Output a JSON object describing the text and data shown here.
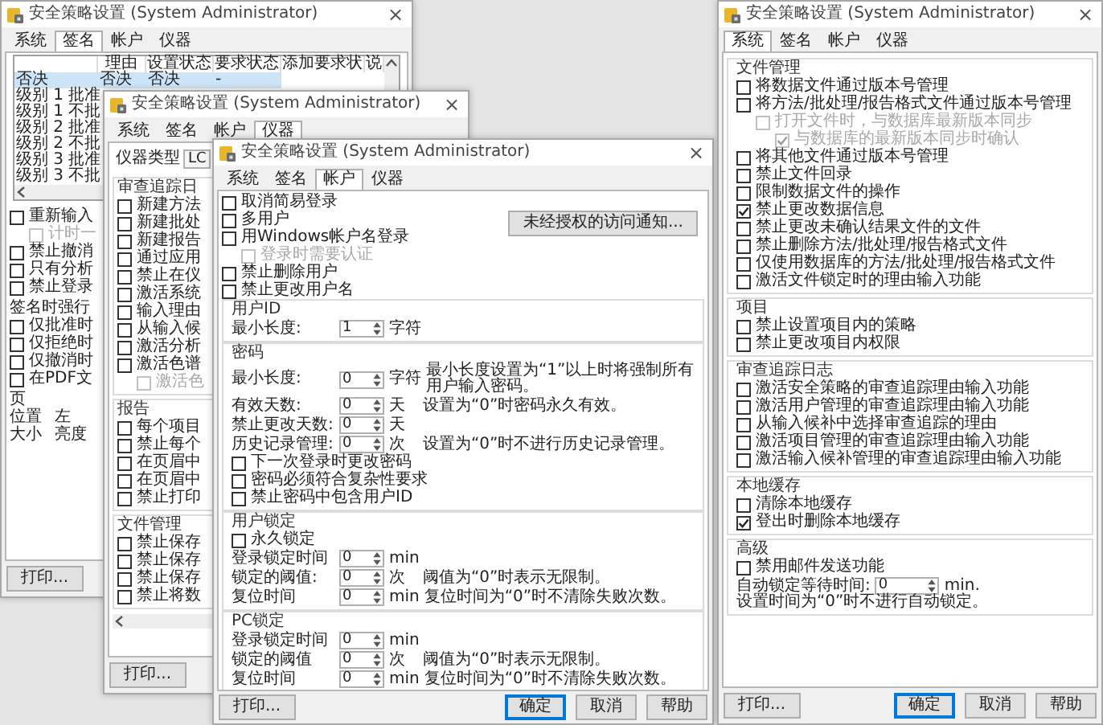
{
  "windows": [
    {
      "title": "安全策略设置 (System Administrator)",
      "close": "×",
      "tabs": [
        {
          "label": "系统",
          "selected": false
        },
        {
          "label": "签名",
          "selected": true
        },
        {
          "label": "帐户",
          "selected": false
        },
        {
          "label": "仪器",
          "selected": false
        }
      ],
      "body": [
        {
          "kind": "table",
          "columns": [
            "理由",
            "设置状态",
            "要求状态",
            "添加要求状",
            "说"
          ],
          "rows": [
            {
              "name": "否决",
              "cells": [
                "否决",
                "否决",
                "-"
              ],
              "selected": true
            },
            {
              "name": "级别 1 批准",
              "selected": false
            },
            {
              "name": "级别 1 不批",
              "selected": false
            },
            {
              "name": "级别 2 批准",
              "selected": false
            },
            {
              "name": "级别 2 不批",
              "selected": false
            },
            {
              "name": "级别 3 批准",
              "selected": false
            },
            {
              "name": "级别 3 不批",
              "selected": false
            }
          ]
        },
        {
          "kind": "checkbox",
          "label": "重新输入",
          "checked": false,
          "disabled": false,
          "children": [
            {
              "kind": "checkbox",
              "label": "计时一",
              "checked": false,
              "disabled": true
            }
          ]
        },
        {
          "kind": "checkbox",
          "label": "禁止撤消",
          "checked": false,
          "disabled": false
        },
        {
          "kind": "checkbox",
          "label": "只有分析",
          "checked": false,
          "disabled": false
        },
        {
          "kind": "checkbox",
          "label": "禁止登录",
          "checked": false,
          "disabled": false
        },
        {
          "kind": "label",
          "text": "签名时强行"
        },
        {
          "kind": "checkbox",
          "label": "仅批准时",
          "checked": false,
          "disabled": false
        },
        {
          "kind": "checkbox",
          "label": "仅拒绝时",
          "checked": false,
          "disabled": false
        },
        {
          "kind": "checkbox",
          "label": "仅撤消时",
          "checked": false,
          "disabled": false
        },
        {
          "kind": "checkbox",
          "label": "在PDF文",
          "checked": false,
          "disabled": false
        },
        {
          "kind": "label",
          "text": "页"
        },
        {
          "kind": "pair",
          "label": "位置",
          "value": "左"
        },
        {
          "kind": "pair",
          "label": "大小",
          "value": "亮度"
        }
      ],
      "buttons": [
        {
          "label": "打印...",
          "kind": "side"
        }
      ]
    },
    {
      "title": "安全策略设置 (System Administrator)",
      "close": "×",
      "tabs": [
        {
          "label": "系统",
          "selected": false
        },
        {
          "label": "签名",
          "selected": false
        },
        {
          "label": "帐户",
          "selected": false
        },
        {
          "label": "仪器",
          "selected": true
        }
      ],
      "body": [
        {
          "kind": "select",
          "label": "仪器类型",
          "value": "LC"
        },
        {
          "kind": "group",
          "title": "审查追踪日",
          "items": [
            {
              "kind": "checkbox",
              "label": "新建方法",
              "checked": false,
              "disabled": false
            },
            {
              "kind": "checkbox",
              "label": "新建批处",
              "checked": false,
              "disabled": false
            },
            {
              "kind": "checkbox",
              "label": "新建报告",
              "checked": false,
              "disabled": false
            },
            {
              "kind": "checkbox",
              "label": "通过应用",
              "checked": false,
              "disabled": false
            },
            {
              "kind": "checkbox",
              "label": "禁止在仪",
              "checked": false,
              "disabled": false
            },
            {
              "kind": "checkbox",
              "label": "激活系统",
              "checked": false,
              "disabled": false
            },
            {
              "kind": "checkbox",
              "label": "输入理由",
              "checked": false,
              "disabled": false
            },
            {
              "kind": "checkbox",
              "label": "从输入候",
              "checked": false,
              "disabled": false
            },
            {
              "kind": "checkbox",
              "label": "激活分析",
              "checked": false,
              "disabled": false
            },
            {
              "kind": "checkbox",
              "label": "激活色谱",
              "checked": false,
              "disabled": false,
              "children": [
                {
                  "kind": "checkbox",
                  "label": "激活色",
                  "checked": false,
                  "disabled": true
                }
              ]
            }
          ]
        },
        {
          "kind": "group",
          "title": "报告",
          "items": [
            {
              "kind": "checkbox",
              "label": "每个项目",
              "checked": false,
              "disabled": false
            },
            {
              "kind": "checkbox",
              "label": "禁止每个",
              "checked": false,
              "disabled": false
            },
            {
              "kind": "checkbox",
              "label": "在页眉中",
              "checked": false,
              "disabled": false
            },
            {
              "kind": "checkbox",
              "label": "在页眉中",
              "checked": false,
              "disabled": false
            },
            {
              "kind": "checkbox",
              "label": "禁止打印",
              "checked": false,
              "disabled": false
            }
          ]
        },
        {
          "kind": "group",
          "title": "文件管理",
          "items": [
            {
              "kind": "checkbox",
              "label": "禁止保存",
              "checked": false,
              "disabled": false
            },
            {
              "kind": "checkbox",
              "label": "禁止保存",
              "checked": false,
              "disabled": false
            },
            {
              "kind": "checkbox",
              "label": "禁止保存",
              "checked": false,
              "disabled": false
            },
            {
              "kind": "checkbox",
              "label": "禁止将数",
              "checked": false,
              "disabled": false
            }
          ]
        },
        {
          "kind": "hscroll"
        }
      ],
      "buttons": [
        {
          "label": "打印...",
          "kind": "side"
        }
      ]
    },
    {
      "title": "安全策略设置 (System Administrator)",
      "close": "×",
      "tabs": [
        {
          "label": "系统",
          "selected": false
        },
        {
          "label": "签名",
          "selected": false
        },
        {
          "label": "帐户",
          "selected": true
        },
        {
          "label": "仪器",
          "selected": false
        }
      ],
      "body": [
        {
          "kind": "split",
          "columns": [
            [
              {
                "kind": "checkbox",
                "label": "取消简易登录",
                "checked": false,
                "disabled": false
              },
              {
                "kind": "checkbox",
                "label": "多用户",
                "checked": false,
                "disabled": false
              },
              {
                "kind": "checkbox",
                "label": "用Windows帐户名登录",
                "checked": false,
                "disabled": false,
                "children": [
                  {
                    "kind": "checkbox",
                    "label": "登录时需要认证",
                    "checked": false,
                    "disabled": true
                  }
                ]
              },
              {
                "kind": "checkbox",
                "label": "禁止删除用户",
                "checked": false,
                "disabled": false
              },
              {
                "kind": "checkbox",
                "label": "禁止更改用户名",
                "checked": false,
                "disabled": false
              }
            ],
            [
              {
                "kind": "button",
                "label": "未经授权的访问通知..."
              }
            ]
          ]
        },
        {
          "kind": "group",
          "title": "用户ID",
          "items": [
            {
              "kind": "spin",
              "label": "最小长度:",
              "value": "1",
              "unit": "字符"
            }
          ]
        },
        {
          "kind": "group",
          "title": "密码",
          "items": [
            {
              "kind": "spin",
              "label": "最小长度:",
              "value": "0",
              "unit": "字符",
              "note": "最小长度设置为“1”以上时将强制所有用户输入密码。"
            },
            {
              "kind": "spin",
              "label": "有效天数:",
              "value": "0",
              "unit": "天",
              "note": "设置为“0”时密码永久有效。"
            },
            {
              "kind": "spin",
              "label": "禁止更改天数:",
              "value": "0",
              "unit": "天"
            },
            {
              "kind": "spin",
              "label": "历史记录管理:",
              "value": "0",
              "unit": "次",
              "note": "设置为“0”时不进行历史记录管理。"
            },
            {
              "kind": "checkbox",
              "label": "下一次登录时更改密码",
              "checked": false,
              "disabled": false
            },
            {
              "kind": "checkbox",
              "label": "密码必须符合复杂性要求",
              "checked": false,
              "disabled": false
            },
            {
              "kind": "checkbox",
              "label": "禁止密码中包含用户ID",
              "checked": false,
              "disabled": false
            }
          ]
        },
        {
          "kind": "group",
          "title": "用户锁定",
          "items": [
            {
              "kind": "checkbox",
              "label": "永久锁定",
              "checked": false,
              "disabled": false
            },
            {
              "kind": "spin",
              "label": "登录锁定时间",
              "value": "0",
              "unit": "min"
            },
            {
              "kind": "spin",
              "label": "锁定的阈值:",
              "value": "0",
              "unit": "次",
              "note": "阈值为“0”时表示无限制。"
            },
            {
              "kind": "spin",
              "label": "复位时间",
              "value": "0",
              "unit": "min",
              "note": "复位时间为“0”时不清除失败次数。"
            }
          ]
        },
        {
          "kind": "group",
          "title": "PC锁定",
          "items": [
            {
              "kind": "spin",
              "label": "登录锁定时间",
              "value": "0",
              "unit": "min"
            },
            {
              "kind": "spin",
              "label": "锁定的阈值",
              "value": "0",
              "unit": "次",
              "note": "阈值为“0”时表示无限制。"
            },
            {
              "kind": "spin",
              "label": "复位时间",
              "value": "0",
              "unit": "min",
              "note": "复位时间为“0”时不清除失败次数。"
            }
          ]
        }
      ],
      "buttons": [
        {
          "label": "打印...",
          "kind": "side"
        },
        {
          "label": "确定",
          "kind": "default"
        },
        {
          "label": "取消",
          "kind": "plain"
        },
        {
          "label": "帮助",
          "kind": "plain"
        }
      ]
    },
    {
      "title": "安全策略设置 (System Administrator)",
      "close": "×",
      "tabs": [
        {
          "label": "系统",
          "selected": true
        },
        {
          "label": "签名",
          "selected": false
        },
        {
          "label": "帐户",
          "selected": false
        },
        {
          "label": "仪器",
          "selected": false
        }
      ],
      "body": [
        {
          "kind": "group",
          "title": "文件管理",
          "items": [
            {
              "kind": "checkbox",
              "label": "将数据文件通过版本号管理",
              "checked": false,
              "disabled": false
            },
            {
              "kind": "checkbox",
              "label": "将方法/批处理/报告格式文件通过版本号管理",
              "checked": false,
              "disabled": false,
              "children": [
                {
                  "kind": "checkbox",
                  "label": "打开文件时，与数据库最新版本同步",
                  "checked": false,
                  "disabled": true,
                  "children": [
                    {
                      "kind": "checkbox",
                      "label": "与数据库的最新版本同步时确认",
                      "checked": true,
                      "disabled": true
                    }
                  ]
                }
              ]
            },
            {
              "kind": "checkbox",
              "label": "将其他文件通过版本号管理",
              "checked": false,
              "disabled": false
            },
            {
              "kind": "checkbox",
              "label": "禁止文件回录",
              "checked": false,
              "disabled": false
            },
            {
              "kind": "checkbox",
              "label": "限制数据文件的操作",
              "checked": false,
              "disabled": false
            },
            {
              "kind": "checkbox",
              "label": "禁止更改数据信息",
              "checked": true,
              "disabled": false
            },
            {
              "kind": "checkbox",
              "label": "禁止更改未确认结果文件的文件",
              "checked": false,
              "disabled": false
            },
            {
              "kind": "checkbox",
              "label": "禁止删除方法/批处理/报告格式文件",
              "checked": false,
              "disabled": false
            },
            {
              "kind": "checkbox",
              "label": "仅使用数据库的方法/批处理/报告格式文件",
              "checked": false,
              "disabled": false
            },
            {
              "kind": "checkbox",
              "label": "激活文件锁定时的理由输入功能",
              "checked": false,
              "disabled": false
            }
          ]
        },
        {
          "kind": "group",
          "title": "项目",
          "items": [
            {
              "kind": "checkbox",
              "label": "禁止设置项目内的策略",
              "checked": false,
              "disabled": false
            },
            {
              "kind": "checkbox",
              "label": "禁止更改项目内权限",
              "checked": false,
              "disabled": false
            }
          ]
        },
        {
          "kind": "group",
          "title": "审查追踪日志",
          "items": [
            {
              "kind": "checkbox",
              "label": "激活安全策略的审查追踪理由输入功能",
              "checked": false,
              "disabled": false
            },
            {
              "kind": "checkbox",
              "label": "激活用户管理的审查追踪理由输入功能",
              "checked": false,
              "disabled": false
            },
            {
              "kind": "checkbox",
              "label": "从输入候补中选择审查追踪的理由",
              "checked": false,
              "disabled": false
            },
            {
              "kind": "checkbox",
              "label": "激活项目管理的审查追踪理由输入功能",
              "checked": false,
              "disabled": false
            },
            {
              "kind": "checkbox",
              "label": "激活输入候补管理的审查追踪理由输入功能",
              "checked": false,
              "disabled": false
            }
          ]
        },
        {
          "kind": "group",
          "title": "本地缓存",
          "items": [
            {
              "kind": "checkbox",
              "label": "清除本地缓存",
              "checked": false,
              "disabled": false
            },
            {
              "kind": "checkbox",
              "label": "登出时删除本地缓存",
              "checked": true,
              "disabled": false
            }
          ]
        },
        {
          "kind": "group",
          "title": "高级",
          "items": [
            {
              "kind": "checkbox",
              "label": "禁用邮件发送功能",
              "checked": false,
              "disabled": false
            },
            {
              "kind": "spin",
              "label": "自动锁定等待时间:",
              "value": "0",
              "unit": "min.",
              "note": "设置时间为“0”时不进行自动锁定。"
            }
          ]
        }
      ],
      "buttons": [
        {
          "label": "打印...",
          "kind": "side"
        },
        {
          "label": "确定",
          "kind": "default"
        },
        {
          "label": "取消",
          "kind": "plain"
        },
        {
          "label": "帮助",
          "kind": "plain"
        }
      ]
    }
  ]
}
